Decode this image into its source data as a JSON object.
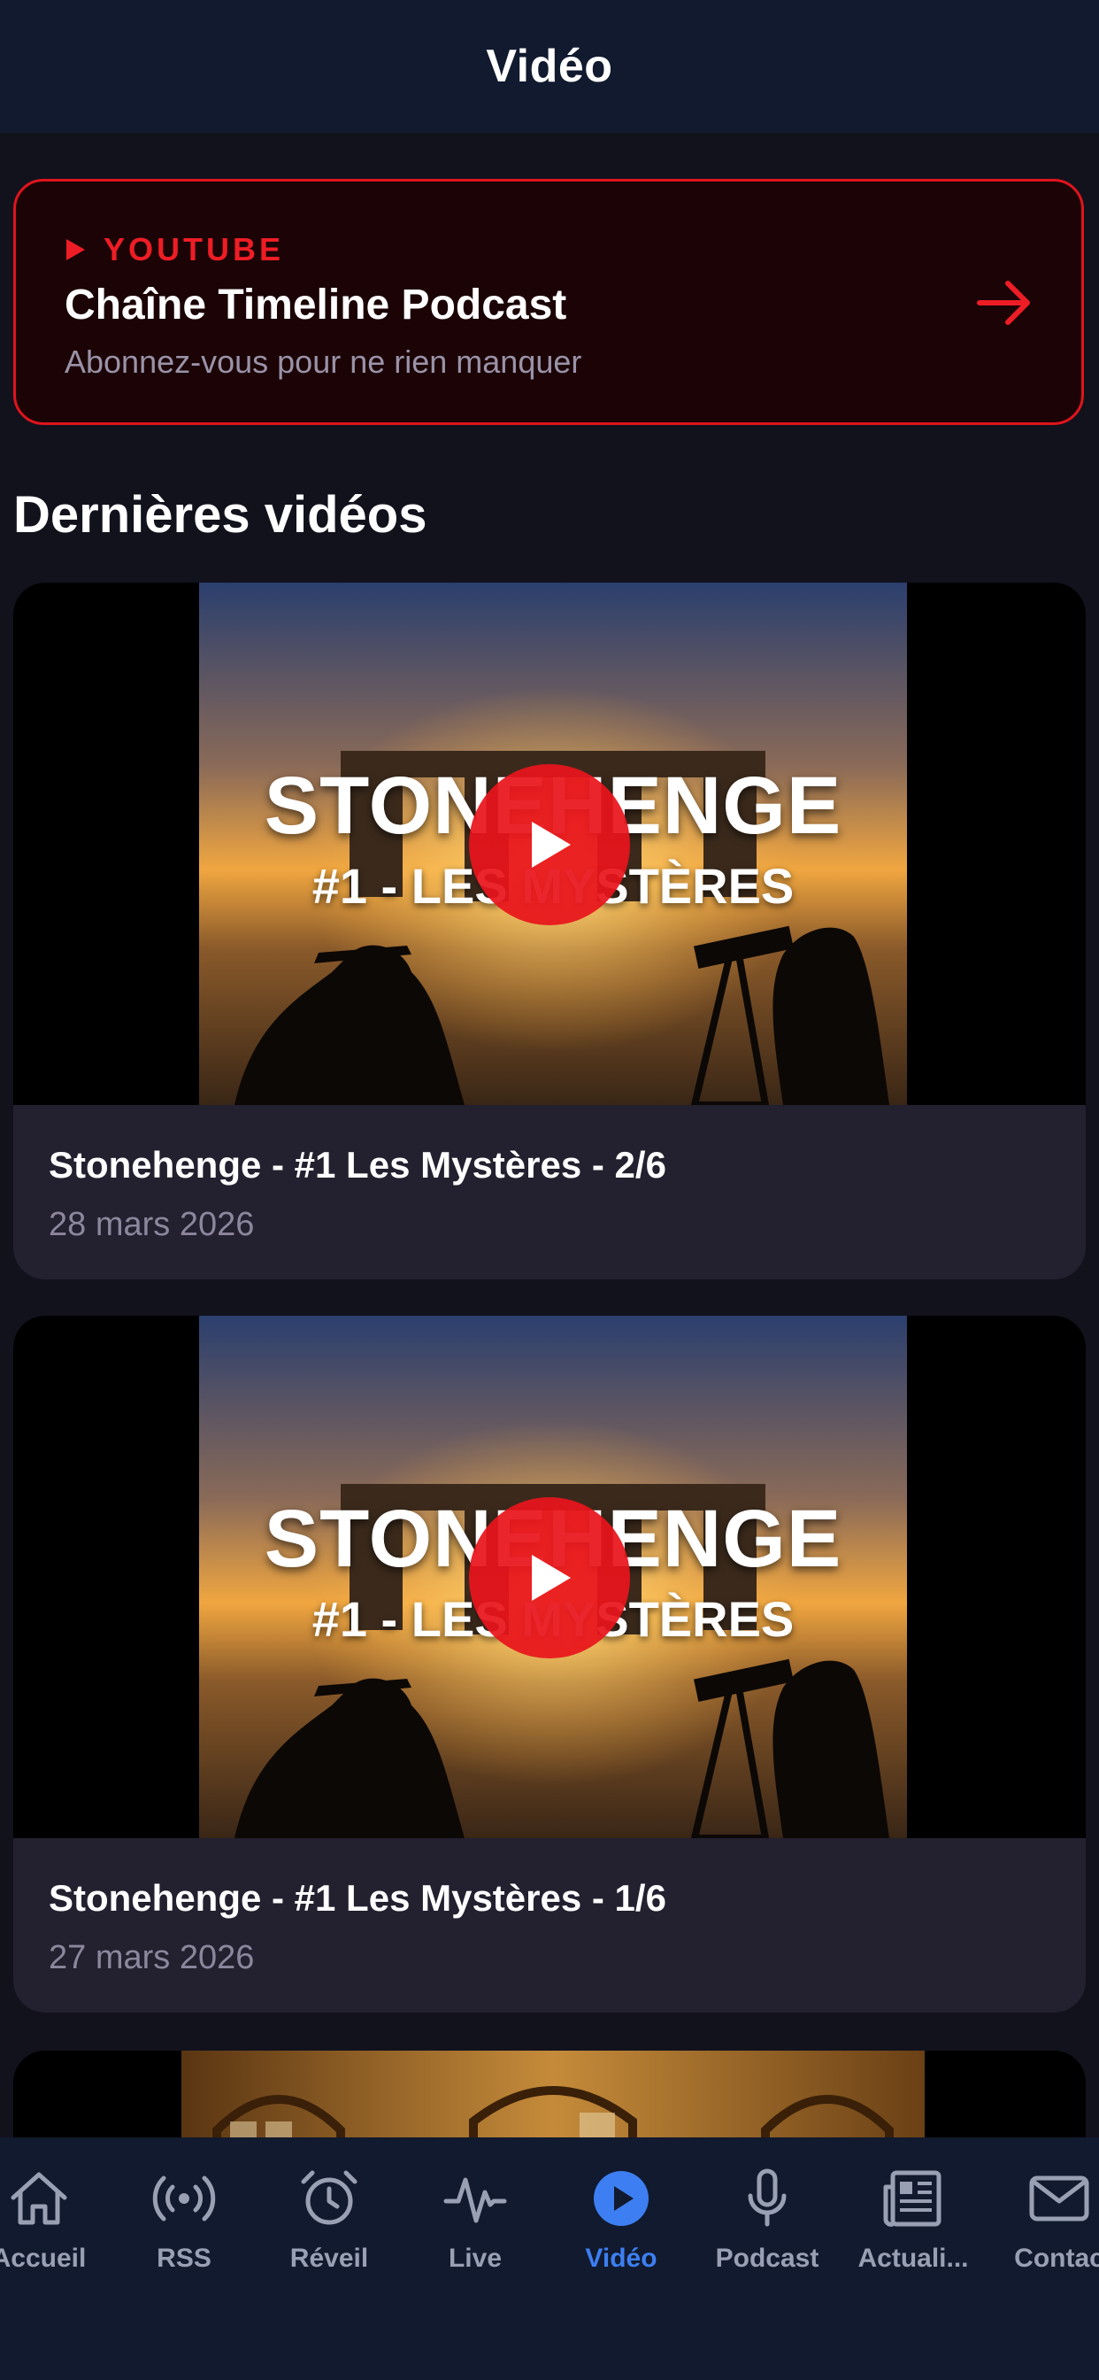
{
  "header": {
    "title": "Vidéo"
  },
  "youtube_card": {
    "kicker": "YOUTUBE",
    "title": "Chaîne Timeline Podcast",
    "subtitle": "Abonnez-vous pour ne rien manquer"
  },
  "section": {
    "title": "Dernières vidéos"
  },
  "videos": [
    {
      "thumbnail_title": "STONEHENGE",
      "thumbnail_subtitle": "#1 - LES MYSTÈRES",
      "title": "Stonehenge - #1 Les Mystères - 2/6",
      "date": "28 mars 2026"
    },
    {
      "thumbnail_title": "STONEHENGE",
      "thumbnail_subtitle": "#1 - LES MYSTÈRES",
      "title": "Stonehenge - #1 Les Mystères - 1/6",
      "date": "27 mars 2026"
    }
  ],
  "tabbar": {
    "items": [
      {
        "label": "Accueil",
        "icon": "home-icon"
      },
      {
        "label": "RSS",
        "icon": "broadcast-icon"
      },
      {
        "label": "Réveil",
        "icon": "alarm-clock-icon"
      },
      {
        "label": "Live",
        "icon": "pulse-icon"
      },
      {
        "label": "Vidéo",
        "icon": "play-circle-icon",
        "active": true
      },
      {
        "label": "Podcast",
        "icon": "microphone-icon"
      },
      {
        "label": "Actuali...",
        "icon": "newspaper-icon"
      },
      {
        "label": "Contac",
        "icon": "mail-icon"
      }
    ]
  },
  "colors": {
    "accent": "#3d7ff2",
    "youtube_red": "#e0141c",
    "background": "#12121d",
    "bars": "#111a2e",
    "card": "#23202f"
  }
}
